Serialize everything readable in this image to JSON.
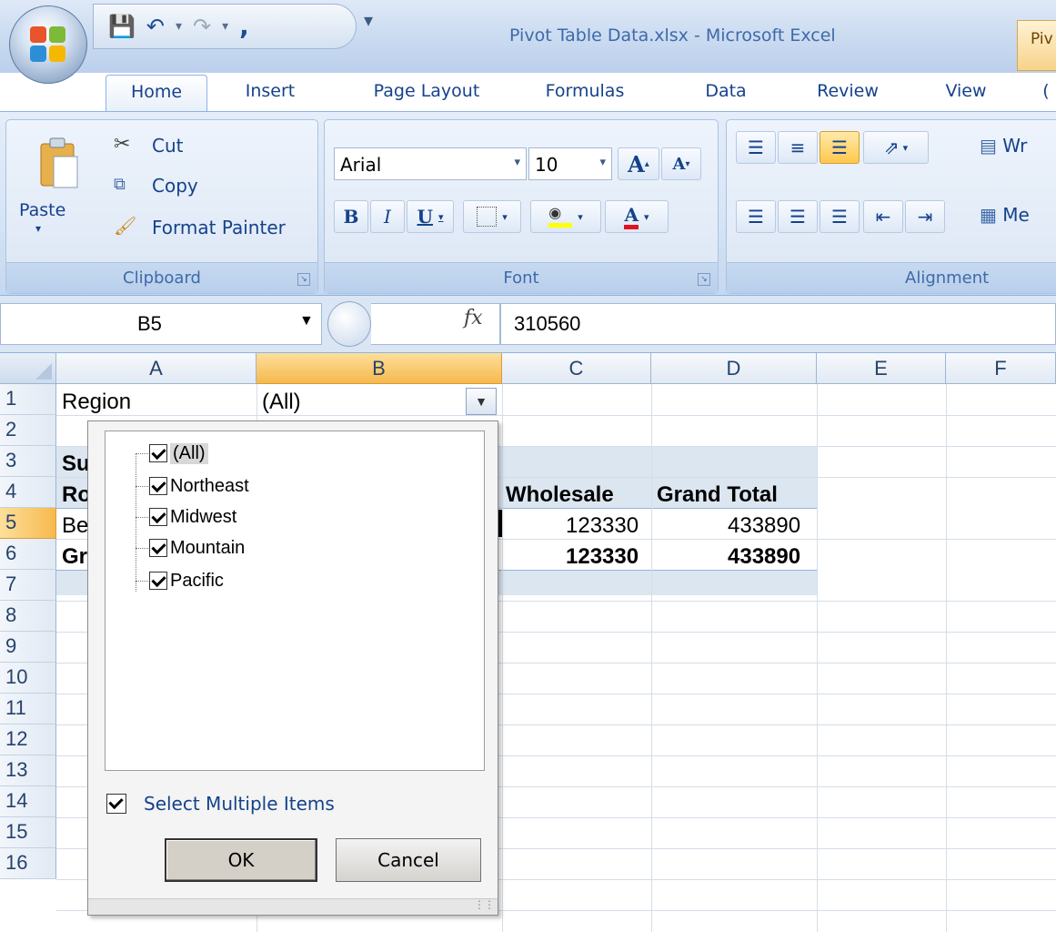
{
  "window": {
    "title": "Pivot Table Data.xlsx - Microsoft Excel",
    "context_tab": "Piv"
  },
  "tabs": [
    "Home",
    "Insert",
    "Page Layout",
    "Formulas",
    "Data",
    "Review",
    "View",
    "("
  ],
  "clipboard": {
    "group_label": "Clipboard",
    "paste": "Paste",
    "cut": "Cut",
    "copy": "Copy",
    "format_painter": "Format Painter"
  },
  "font": {
    "group_label": "Font",
    "font_name": "Arial",
    "font_size": "10",
    "grow": "A",
    "shrink": "A",
    "bold": "B",
    "italic": "I",
    "underline": "U",
    "font_color": "A"
  },
  "alignment": {
    "group_label": "Alignment",
    "wrap": "Wr",
    "merge": "Me"
  },
  "formula_bar": {
    "name_box": "B5",
    "fx": "fx",
    "value": "310560"
  },
  "columns": [
    "A",
    "B",
    "C",
    "D",
    "E",
    "F"
  ],
  "rows": [
    "1",
    "2",
    "3",
    "4",
    "5",
    "6",
    "7",
    "8",
    "9",
    "10",
    "11",
    "12",
    "13",
    "14",
    "15",
    "16"
  ],
  "cells": {
    "a1": "Region",
    "b1": "(All)",
    "a3": "Su",
    "a4": "Ro",
    "a5": "Be",
    "a6": "Gr",
    "c4": "Wholesale",
    "d4": "Grand Total",
    "c5": "123330",
    "d5": "433890",
    "c6": "123330",
    "d6": "433890"
  },
  "filter_popup": {
    "items": [
      "(All)",
      "Northeast",
      "Midwest",
      "Mountain",
      "Pacific"
    ],
    "select_multiple": "Select Multiple Items",
    "ok": "OK",
    "cancel": "Cancel"
  },
  "colors": {
    "ribbon": "#d7e5f6",
    "selected_header": "#f6b94e",
    "pivot_band": "#dce6f1"
  }
}
